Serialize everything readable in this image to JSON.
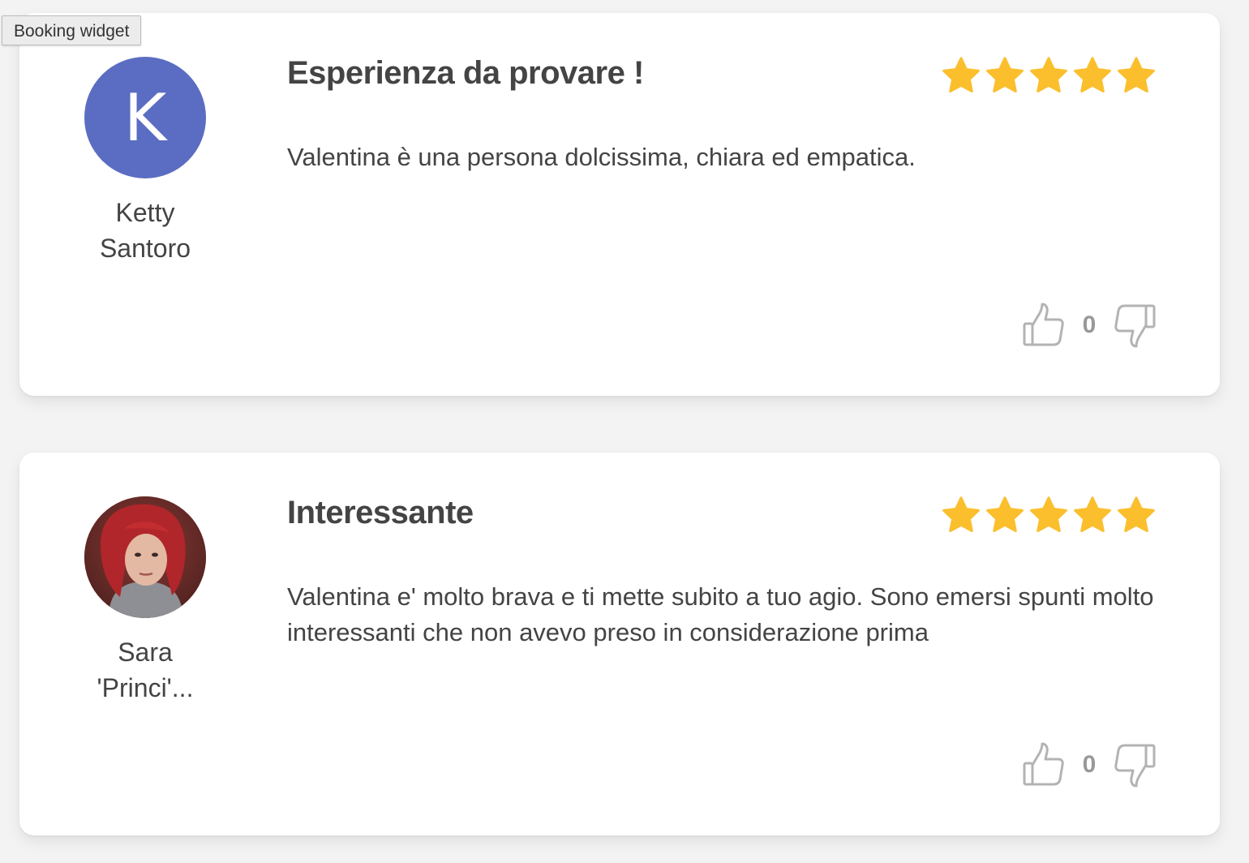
{
  "tooltip": {
    "text": "Booking widget"
  },
  "reviews": [
    {
      "avatar_initial": "K",
      "avatar_color": "#5b6dc2",
      "name_line1": "Ketty",
      "name_line2": "Santoro",
      "title": "Esperienza da provare !",
      "rating": 5,
      "rating_max": 5,
      "text": "Valentina è una persona dolcissima, chiara ed empatica.",
      "vote_count": "0"
    },
    {
      "avatar_initial": "",
      "name_line1": "Sara",
      "name_line2": "'Princi'...",
      "title": "Interessante",
      "rating": 5,
      "rating_max": 5,
      "text": "Valentina e' molto brava e ti mette subito a tuo agio. Sono emersi spunti molto interessanti che non avevo preso in considerazione prima",
      "vote_count": "0"
    }
  ],
  "colors": {
    "star": "#fbbf2d",
    "text": "#444444",
    "vote_icon": "#b3b3b3",
    "background": "#f3f3f3"
  }
}
